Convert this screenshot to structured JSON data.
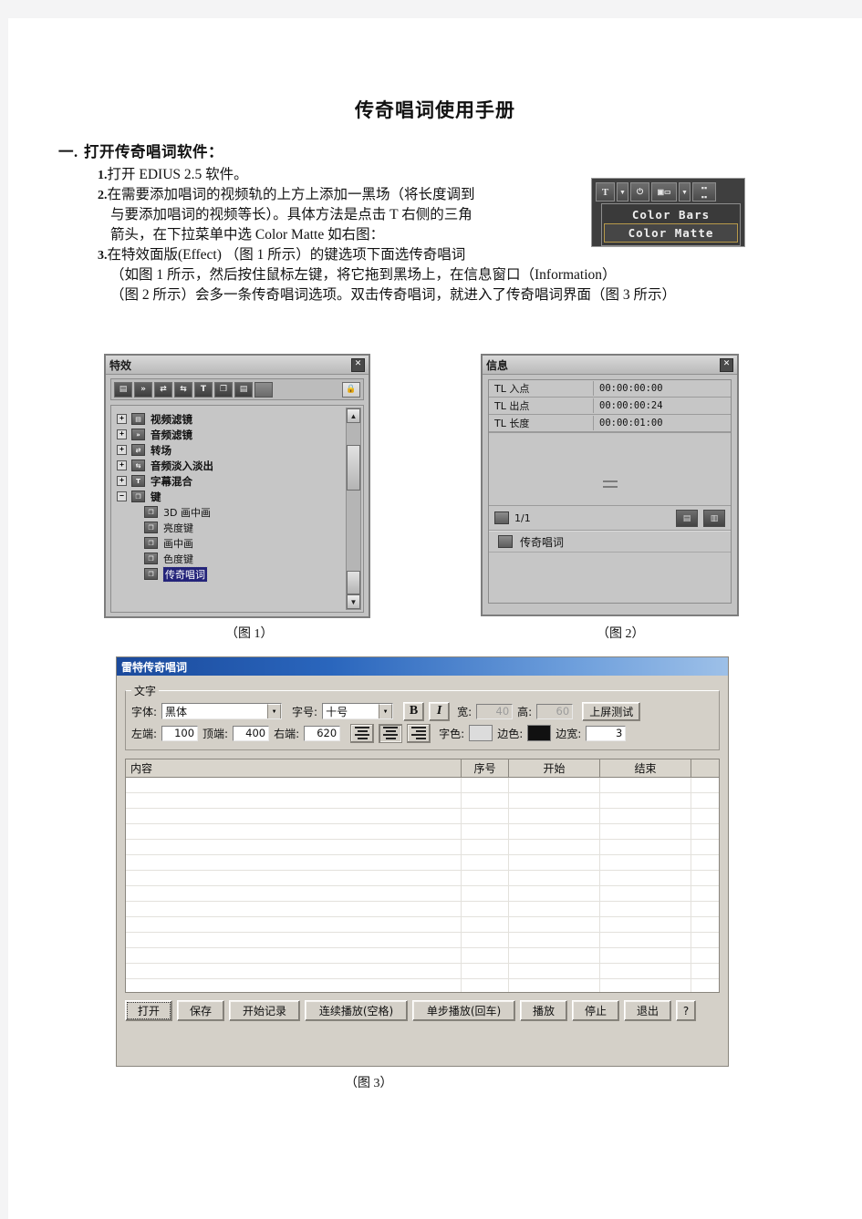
{
  "document": {
    "title": "传奇唱词使用手册",
    "section": {
      "number": "一.",
      "heading": "打开传奇唱词软件："
    },
    "items": [
      {
        "marker": "1.",
        "lines": [
          "打开 EDIUS 2.5 软件。"
        ]
      },
      {
        "marker": "2.",
        "lines": [
          "在需要添加唱词的视频轨的上方上添加一黑场（将长度调到",
          "与要添加唱词的视频等长）。具体方法是点击 T 右侧的三角",
          "箭头，在下拉菜单中选 Color Matte 如右图："
        ]
      },
      {
        "marker": "3.",
        "lines": [
          "在特效面版(Effect) （图 1 所示）的键选项下面选传奇唱词",
          "（如图 1 所示，然后按住鼠标左键，将它拖到黑场上，在信息窗口（Information）",
          "（图 2 所示）会多一条传奇唱词选项。双击传奇唱词，就进入了传奇唱词界面（图 3 所示）"
        ]
      }
    ],
    "captions": {
      "fig1": "（图  1）",
      "fig2": "（图 2）",
      "fig3": "（图 3）"
    }
  },
  "toolbar_shot": {
    "buttons": [
      "T",
      "caret-down",
      "mic",
      "color-matte",
      "caret-down",
      "grid"
    ],
    "menu": [
      {
        "label": "Color Bars",
        "selected": false
      },
      {
        "label": "Color Matte",
        "selected": true
      }
    ]
  },
  "effect_panel": {
    "title": "特效",
    "close": "✕",
    "lock_icon": "lock-icon",
    "toolbar_icons": [
      "video-filter-icon",
      "audio-filter-icon",
      "transition-icon",
      "audio-crossfade-icon",
      "title-mix-icon",
      "key-icon",
      "clip-icon",
      "blank-icon"
    ],
    "tree": [
      {
        "label": "视频滤镜",
        "expander": "+",
        "level": 0
      },
      {
        "label": "音频滤镜",
        "expander": "+",
        "level": 0
      },
      {
        "label": "转场",
        "expander": "+",
        "level": 0
      },
      {
        "label": "音频淡入淡出",
        "expander": "+",
        "level": 0
      },
      {
        "label": "字幕混合",
        "expander": "+",
        "level": 0
      },
      {
        "label": "键",
        "expander": "−",
        "level": 0
      },
      {
        "label": "3D 画中画",
        "expander": "",
        "level": 1
      },
      {
        "label": "亮度键",
        "expander": "",
        "level": 1
      },
      {
        "label": "画中画",
        "expander": "",
        "level": 1
      },
      {
        "label": "色度键",
        "expander": "",
        "level": 1
      },
      {
        "label": "传奇唱词",
        "expander": "",
        "level": 1,
        "selected": true
      }
    ],
    "scroll_up": "▲",
    "scroll_down": "▼"
  },
  "info_panel": {
    "title": "信息",
    "close": "✕",
    "rows": [
      {
        "key": "TL 入点",
        "value": "00:00:00:00"
      },
      {
        "key": "TL 出点",
        "value": "00:00:00:24"
      },
      {
        "key": "TL 长度",
        "value": "00:00:01:00"
      }
    ],
    "page_indicator": "1/1",
    "list_item": "传奇唱词"
  },
  "app_window": {
    "title": "雷特传奇唱词",
    "text_group": {
      "legend": "文字",
      "font_label": "字体:",
      "font_value": "黑体",
      "size_label": "字号:",
      "size_value": "十号",
      "bold_label": "B",
      "italic_label": "I",
      "width_label": "宽:",
      "width_value": "40",
      "height_label": "高:",
      "height_value": "60",
      "test_button": "上屏测试",
      "left_label": "左端:",
      "left_value": "100",
      "top_label": "顶端:",
      "top_value": "400",
      "right_label": "右端:",
      "right_value": "620",
      "align_left": "align-left-icon",
      "align_center": "align-center-icon",
      "align_right": "align-right-icon",
      "textcolor_label": "字色:",
      "textcolor_value": "#dcdcdc",
      "edgecolor_label": "边色:",
      "edgecolor_value": "#111111",
      "edgewidth_label": "边宽:",
      "edgewidth_value": "3"
    },
    "table": {
      "headers": [
        "内容",
        "序号",
        "开始",
        "结束",
        ""
      ],
      "row_count": 15,
      "rows": []
    },
    "buttons": [
      {
        "label": "打开",
        "focused": true
      },
      {
        "label": "保存"
      },
      {
        "label": "开始记录"
      },
      {
        "label": "连续播放(空格)"
      },
      {
        "label": "单步播放(回车)"
      },
      {
        "label": "播放"
      },
      {
        "label": "停止"
      },
      {
        "label": "退出"
      },
      {
        "label": "?"
      }
    ]
  }
}
